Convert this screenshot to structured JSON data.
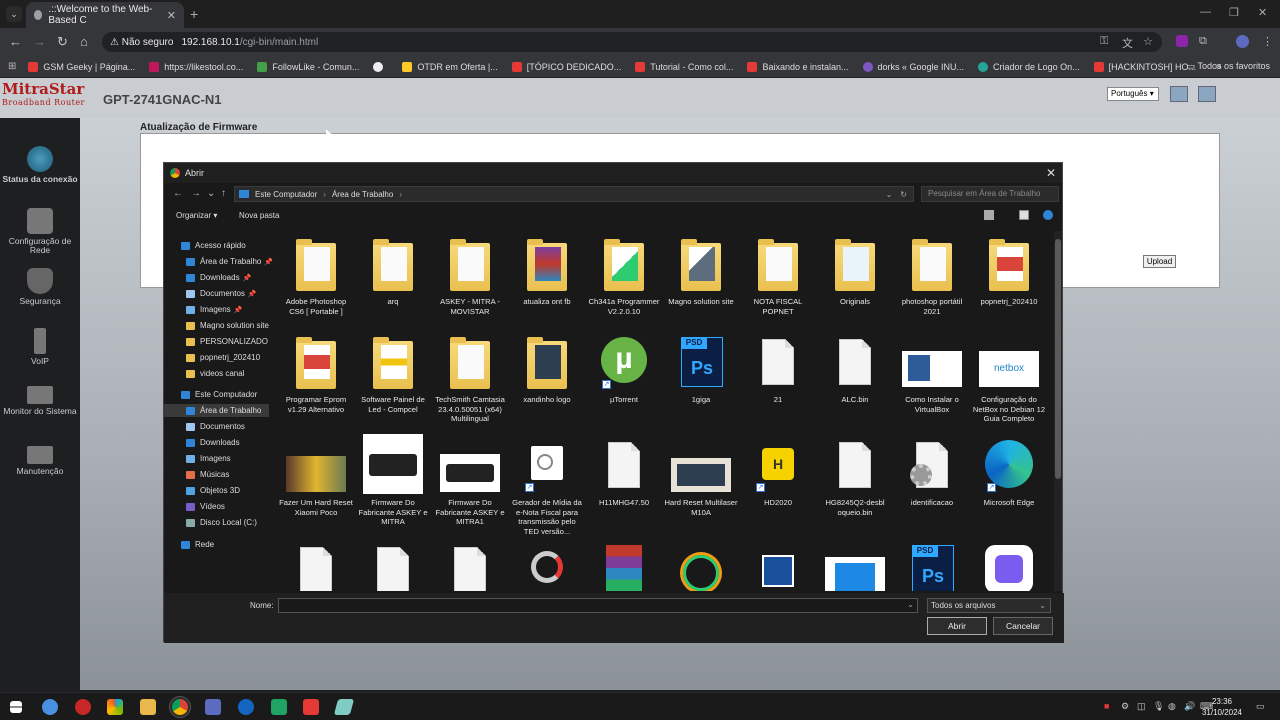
{
  "browser": {
    "tab_title": ".::Welcome to the Web-Based C",
    "security_label": "Não seguro",
    "url_host": "192.168.10.1",
    "url_path": "/cgi-bin/main.html",
    "bookmarks": [
      {
        "label": "GSM Geeky | Página...",
        "color": "#e53935"
      },
      {
        "label": "https://likestool.co...",
        "color": "#c2185b"
      },
      {
        "label": "FollowLike - Comun...",
        "color": "#43a047"
      },
      {
        "label": "",
        "color": "#eeeeee"
      },
      {
        "label": "OTDR em Oferta |...",
        "color": "#ffca28"
      },
      {
        "label": "[TÓPICO DEDICADO...",
        "color": "#e53935"
      },
      {
        "label": "Tutorial - Como col...",
        "color": "#e53935"
      },
      {
        "label": "Baixando e instalan...",
        "color": "#e53935"
      },
      {
        "label": "dorks « Google INU...",
        "color": "#7e57c2"
      },
      {
        "label": "Criador de Logo On...",
        "color": "#26a69a"
      },
      {
        "label": "[HACKINTOSH] HO...",
        "color": "#e53935"
      }
    ],
    "all_bookmarks": "Todos os favoritos"
  },
  "router": {
    "logo_main": "MitraStar",
    "logo_sub": "Broadband Router",
    "model": "GPT-2741GNAC-N1",
    "language": "Português",
    "page_title": "Atualização de Firmware",
    "upload_label": "Upload",
    "sidebar": [
      {
        "label": "Status da conexão",
        "icon": "globe-icon"
      },
      {
        "label": "Configuração de Rede",
        "icon": "gears-icon"
      },
      {
        "label": "Segurança",
        "icon": "shield-icon"
      },
      {
        "label": "VoIP",
        "icon": "phone-icon"
      },
      {
        "label": "Monitor do Sistema",
        "icon": "monitor-icon"
      },
      {
        "label": "Manutenção",
        "icon": "wrench-icon"
      }
    ]
  },
  "dialog": {
    "title": "Abrir",
    "breadcrumb": [
      "Este Computador",
      "Área de Trabalho"
    ],
    "search_placeholder": "Pesquisar em Área de Trabalho",
    "organize": "Organizar",
    "new_folder": "Nova pasta",
    "tree": [
      {
        "label": "Acesso rápido",
        "pinned": false
      },
      {
        "label": "Área de Trabalho",
        "pinned": true
      },
      {
        "label": "Downloads",
        "pinned": true
      },
      {
        "label": "Documentos",
        "pinned": true
      },
      {
        "label": "Imagens",
        "pinned": true
      },
      {
        "label": "Magno solution site",
        "pinned": false
      },
      {
        "label": "PERSONALIZADO",
        "pinned": false
      },
      {
        "label": "popnetrj_202410",
        "pinned": false
      },
      {
        "label": "videos canal",
        "pinned": false
      },
      {
        "label": "Este Computador",
        "pinned": false
      },
      {
        "label": "Área de Trabalho",
        "pinned": false
      },
      {
        "label": "Documentos",
        "pinned": false
      },
      {
        "label": "Downloads",
        "pinned": false
      },
      {
        "label": "Imagens",
        "pinned": false
      },
      {
        "label": "Músicas",
        "pinned": false
      },
      {
        "label": "Objetos 3D",
        "pinned": false
      },
      {
        "label": "Vídeos",
        "pinned": false
      },
      {
        "label": "Disco Local (C:)",
        "pinned": false
      },
      {
        "label": "Rede",
        "pinned": false
      }
    ],
    "files": [
      {
        "label": "Adobe Photoshop CS6 [ Portable ]",
        "kind": "folder"
      },
      {
        "label": "arq",
        "kind": "folder"
      },
      {
        "label": "ASKEY - MITRA - MOVISTAR",
        "kind": "folder"
      },
      {
        "label": "atualiza ont fb",
        "kind": "folder"
      },
      {
        "label": "Ch341a Programmer V2.2.0.10",
        "kind": "folder"
      },
      {
        "label": "Magno solution site",
        "kind": "folder"
      },
      {
        "label": "NOTA FISCAL POPNET",
        "kind": "folder"
      },
      {
        "label": "Originals",
        "kind": "folder"
      },
      {
        "label": "photoshop portátil 2021",
        "kind": "folder"
      },
      {
        "label": "popnetrj_202410",
        "kind": "folder"
      },
      {
        "label": "Programar Eprom v1.29 Alternativo",
        "kind": "folder"
      },
      {
        "label": "Software Painel de Led - Compcel",
        "kind": "folder"
      },
      {
        "label": "TechSmith Camtasia 23.4.0.50051 (x64) Multilingual",
        "kind": "folder"
      },
      {
        "label": "xandinho logo",
        "kind": "folder"
      },
      {
        "label": "µTorrent",
        "kind": "utorrent"
      },
      {
        "label": "1giga",
        "kind": "psd"
      },
      {
        "label": "21",
        "kind": "doc"
      },
      {
        "label": "ALC.bin",
        "kind": "doc"
      },
      {
        "label": "Como Instalar o VirtualBox",
        "kind": "image"
      },
      {
        "label": "Configuração do NetBox no Debian 12 Guia Completo",
        "kind": "netbox"
      },
      {
        "label": "Fazer Um Hard Reset Xiaomi Poco",
        "kind": "image"
      },
      {
        "label": "Firmware Do Fabricante ASKEY e MITRA",
        "kind": "router"
      },
      {
        "label": "Firmware Do Fabricante ASKEY e MITRA1",
        "kind": "router"
      },
      {
        "label": "Gerador de Mídia da e-Nota Fiscal para transmissão pelo TED versão...",
        "kind": "app"
      },
      {
        "label": "H11MHG47.50",
        "kind": "doc"
      },
      {
        "label": "Hard Reset Multilaser M10A",
        "kind": "image"
      },
      {
        "label": "HD2020",
        "kind": "hd"
      },
      {
        "label": "HG8245Q2-desbl oqueio.bin",
        "kind": "doc"
      },
      {
        "label": "identificacao",
        "kind": "gear"
      },
      {
        "label": "Microsoft Edge",
        "kind": "edge"
      },
      {
        "label": "",
        "kind": "doc"
      },
      {
        "label": "",
        "kind": "doc"
      },
      {
        "label": "",
        "kind": "doc"
      },
      {
        "label": "",
        "kind": "app"
      },
      {
        "label": "",
        "kind": "winrar"
      },
      {
        "label": "",
        "kind": "app"
      },
      {
        "label": "",
        "kind": "app"
      },
      {
        "label": "",
        "kind": "image"
      },
      {
        "label": "",
        "kind": "psd"
      },
      {
        "label": "",
        "kind": "app"
      }
    ],
    "name_label": "Nome:",
    "file_type": "Todos os arquivos",
    "open_button": "Abrir",
    "cancel_button": "Cancelar"
  },
  "taskbar": {
    "time": "23:36",
    "date": "31/10/2024"
  }
}
